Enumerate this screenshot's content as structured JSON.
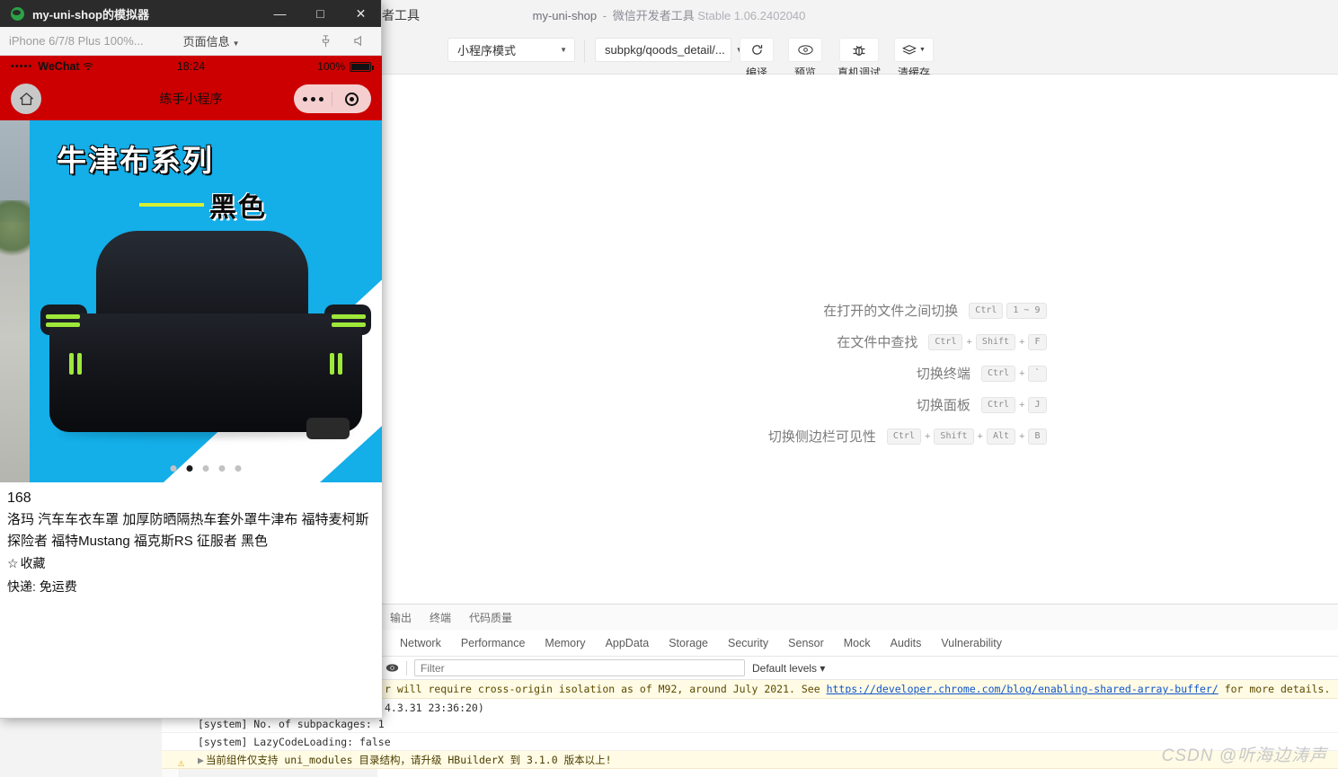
{
  "ide": {
    "title_left": "者工具",
    "title_project": "my-uni-shop",
    "title_sep": "-",
    "title_app": "微信开发者工具",
    "title_version": "Stable 1.06.2402040",
    "toolbar": {
      "mode_select": "小程序模式",
      "page_select": "subpkg/qoods_detail/...",
      "buttons": [
        {
          "icon": "refresh-icon",
          "label": "编译"
        },
        {
          "icon": "eye-icon",
          "label": "预览"
        },
        {
          "icon": "bug-icon",
          "label": "真机调试"
        },
        {
          "icon": "layers-icon",
          "label": "清缓存"
        }
      ]
    },
    "shortcuts": [
      {
        "text": "在打开的文件之间切换",
        "keys": [
          "Ctrl",
          "1 ~ 9"
        ],
        "seps": [
          ""
        ]
      },
      {
        "text": "在文件中查找",
        "keys": [
          "Ctrl",
          "Shift",
          "F"
        ],
        "seps": [
          "+",
          "+"
        ]
      },
      {
        "text": "切换终端",
        "keys": [
          "Ctrl",
          "`"
        ],
        "seps": [
          "+"
        ]
      },
      {
        "text": "切换面板",
        "keys": [
          "Ctrl",
          "J"
        ],
        "seps": [
          "+"
        ]
      },
      {
        "text": "切换侧边栏可见性",
        "keys": [
          "Ctrl",
          "Shift",
          "Alt",
          "B"
        ],
        "seps": [
          "+",
          "+",
          "+"
        ]
      }
    ]
  },
  "devtools": {
    "top_tabs": [
      "输出",
      "终端",
      "代码质量"
    ],
    "tabs": [
      "Network",
      "Performance",
      "Memory",
      "AppData",
      "Storage",
      "Security",
      "Sensor",
      "Mock",
      "Audits",
      "Vulnerability"
    ],
    "filter_placeholder": "Filter",
    "levels_label": "Default levels ▾",
    "eye_icon": "eye-icon",
    "logs": [
      {
        "type": "warn",
        "text_before": "r will require cross-origin isolation as of M92, around July 2021. See ",
        "link": "https://developer.chrome.com/blog/enabling-shared-array-buffer/",
        "text_after": " for more details."
      },
      {
        "type": "plain",
        "text": "4.3.31 23:36:20)"
      },
      {
        "type": "plain",
        "text": "1"
      },
      {
        "type": "plain",
        "text": "se"
      }
    ],
    "left_logs": [
      {
        "type": "plain",
        "text": "[system] No. of subpackages: 1"
      },
      {
        "type": "plain",
        "text": "[system] LazyCodeLoading: false"
      },
      {
        "type": "warn",
        "text": "当前组件仅支持 uni_modules 目录结构，请升级 HBuilderX 到 3.1.0 版本以上!"
      }
    ]
  },
  "watermark": "CSDN @听海边涛声",
  "simulator": {
    "window_title": "my-uni-shop的模拟器",
    "logo_icon": "wechat-icon",
    "window_buttons": [
      {
        "name": "minimize-button",
        "glyph": "—"
      },
      {
        "name": "maximize-button",
        "glyph": "□"
      },
      {
        "name": "close-button",
        "glyph": "✕"
      }
    ],
    "device": "iPhone 6/7/8 Plus 100%...",
    "page_info_label": "页面信息",
    "icons": [
      {
        "name": "pin-icon"
      },
      {
        "name": "volume-icon"
      }
    ],
    "statusbar": {
      "signal_dots": "•••••",
      "carrier": "WeChat",
      "wifi_icon": "wifi-icon",
      "time": "18:24",
      "battery_pct": "100%",
      "bg": "#CC0000"
    },
    "navbar": {
      "home_icon": "home-icon",
      "title": "练手小程序",
      "capsule": {
        "menu_icon": "more-dots-icon",
        "target_icon": "target-icon"
      }
    },
    "swiper": {
      "banner_main": "牛津布系列",
      "banner_sub": "黑色",
      "dots_count": 5,
      "active_dot": 1,
      "accent": "#14AEE8"
    },
    "product": {
      "price": "168",
      "name": "洛玛 汽车车衣车罩 加厚防晒隔热车套外罩牛津布 福特麦柯斯 探险者 福特Mustang 福克斯RS 征服者 黑色",
      "fav_icon": "star-icon",
      "fav_label": "收藏",
      "shipping": "快递: 免运费"
    }
  }
}
